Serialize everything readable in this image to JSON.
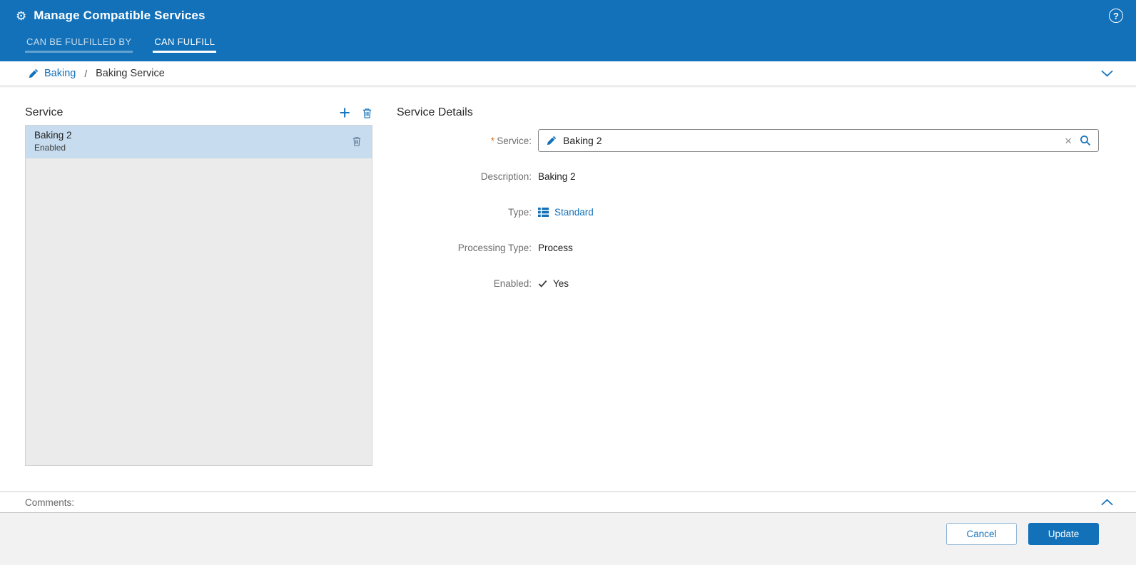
{
  "colors": {
    "header_bg": "#1271b9",
    "accent": "#1271b9",
    "selected_item_bg": "#c7dcee",
    "required_marker_color": "#e0731d",
    "list_bg": "#ebebeb",
    "footer_bg": "#f2f2f2"
  },
  "header": {
    "title": "Manage Compatible Services",
    "tabs": [
      {
        "label": "CAN BE FULFILLED BY",
        "active": false
      },
      {
        "label": "CAN FULFILL",
        "active": true
      }
    ]
  },
  "breadcrumb": {
    "link_label": "Baking",
    "separator": "/",
    "current": "Baking Service"
  },
  "service_panel": {
    "title": "Service",
    "items": [
      {
        "name": "Baking 2",
        "status": "Enabled",
        "selected": true
      }
    ]
  },
  "details": {
    "title": "Service Details",
    "required_marker": "*",
    "service": {
      "label": "Service:",
      "value": "Baking 2"
    },
    "description": {
      "label": "Description:",
      "value": "Baking 2"
    },
    "type": {
      "label": "Type:",
      "value": "Standard"
    },
    "processing_type": {
      "label": "Processing Type:",
      "value": "Process"
    },
    "enabled": {
      "label": "Enabled:",
      "value": "Yes"
    }
  },
  "comments": {
    "label": "Comments:"
  },
  "footer": {
    "cancel_label": "Cancel",
    "update_label": "Update"
  },
  "icons": {
    "gear": "⚙",
    "help": "?",
    "plus": "+",
    "clear": "×"
  }
}
